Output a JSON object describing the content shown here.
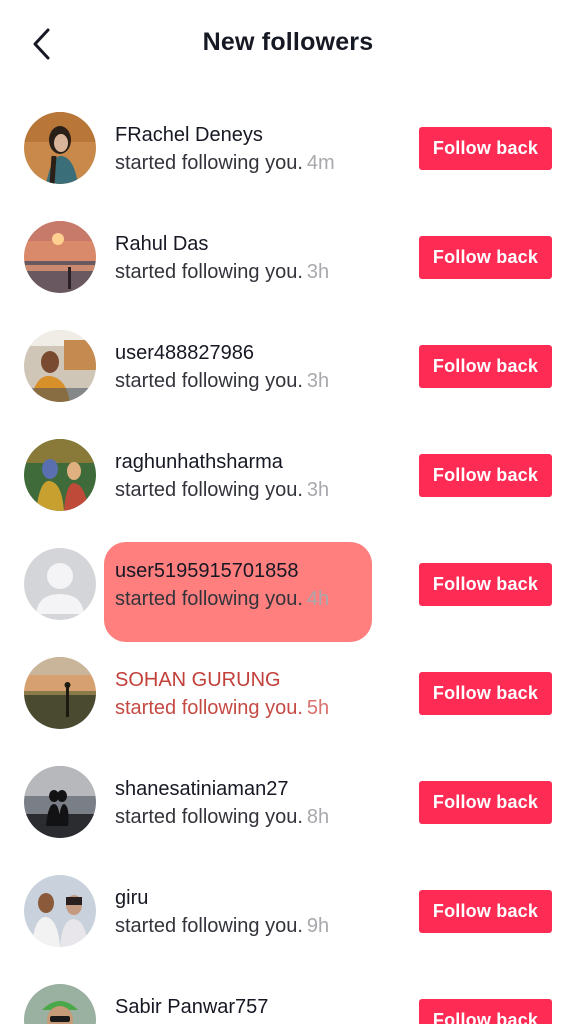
{
  "header": {
    "title": "New followers",
    "back_icon": "chevron-left-icon"
  },
  "colors": {
    "accent": "#fe2c55",
    "highlight": "#ff7f7f"
  },
  "followers": [
    {
      "name": "FRachel Deneys",
      "action": "started following you.",
      "time": "4m",
      "button": "Follow back",
      "avatar": "woman-portrait"
    },
    {
      "name": "Rahul Das",
      "action": "started following you.",
      "time": "3h",
      "button": "Follow back",
      "avatar": "sunset"
    },
    {
      "name": "user488827986",
      "action": "started following you.",
      "time": "3h",
      "button": "Follow back",
      "avatar": "man-outdoors"
    },
    {
      "name": "raghunhathsharma",
      "action": "started following you.",
      "time": "3h",
      "button": "Follow back",
      "avatar": "deity-art"
    },
    {
      "name": "user5195915701858",
      "action": "started following you.",
      "time": "4h",
      "button": "Follow back",
      "avatar": "default-user"
    },
    {
      "name": "SOHAN GURUNG",
      "action": "started following you.",
      "time": "5h",
      "button": "Follow back",
      "avatar": "field-silhouette"
    },
    {
      "name": "shanesatiniaman27",
      "action": "started following you.",
      "time": "8h",
      "button": "Follow back",
      "avatar": "couple-silhouette"
    },
    {
      "name": "giru",
      "action": "started following you.",
      "time": "9h",
      "button": "Follow back",
      "avatar": "couple-photo"
    },
    {
      "name": "Sabir Panwar757",
      "action": "",
      "time": "",
      "button": "Follow back",
      "avatar": "man-cap"
    }
  ]
}
